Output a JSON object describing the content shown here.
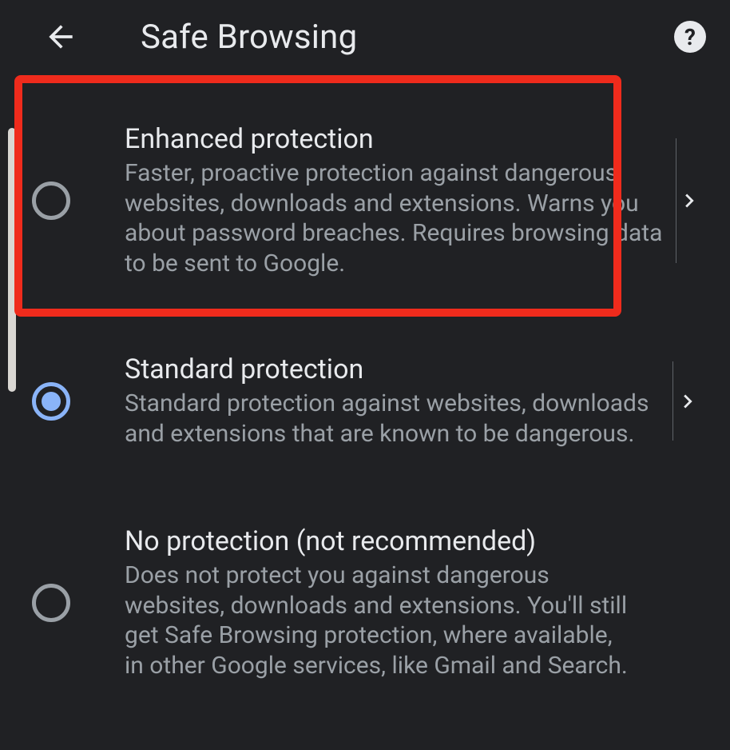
{
  "header": {
    "title": "Safe Browsing"
  },
  "options": [
    {
      "title": "Enhanced protection",
      "description": "Faster, proactive protection against dangerous websites, downloads and extensions. Warns you about password breaches. Requires browsing data to be sent to Google.",
      "selected": false,
      "hasDetails": true,
      "highlighted": true
    },
    {
      "title": "Standard protection",
      "description": "Standard protection against websites, downloads and extensions that are known to be dangerous.",
      "selected": true,
      "hasDetails": true,
      "highlighted": false
    },
    {
      "title": "No protection (not recommended)",
      "description": "Does not protect you against dangerous websites, downloads and extensions. You'll still get Safe Browsing protection, where available, in other Google services, like Gmail and Search.",
      "selected": false,
      "hasDetails": false,
      "highlighted": false
    }
  ]
}
